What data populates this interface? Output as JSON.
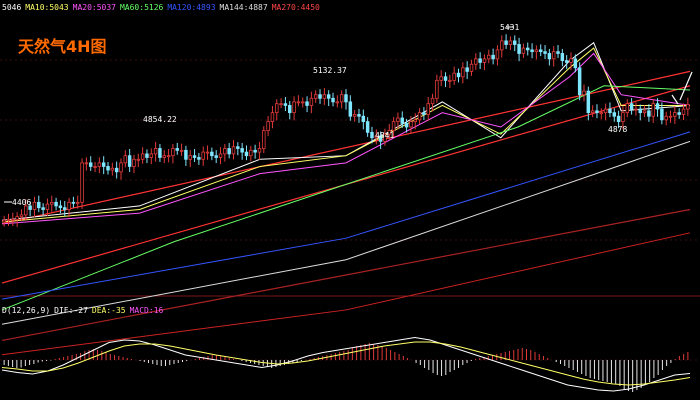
{
  "chart_data": {
    "type": "candlestick",
    "title": "天然气4H图",
    "colors": {
      "background": "#000000",
      "bull": "#e23a3a",
      "bear": "#7fe7ff",
      "title": "#ff6a00",
      "grid": "#7a1a1a"
    },
    "ma_legend": [
      {
        "label": "5046",
        "color": "#ffffff"
      },
      {
        "label": "MA10:5043",
        "color": "#ffff66"
      },
      {
        "label": "MA20:5037",
        "color": "#ff55ff"
      },
      {
        "label": "MA60:5126",
        "color": "#66ff66"
      },
      {
        "label": "MA120:4893",
        "color": "#3355ff"
      },
      {
        "label": "MA144:4887",
        "color": "#dddddd"
      },
      {
        "label": "MA270:4450",
        "color": "#ff4444"
      }
    ],
    "price_labels": [
      "4406",
      "4854.22",
      "5132.37",
      "4841",
      "5431",
      "4878"
    ],
    "ylim": [
      4000,
      5550
    ],
    "close": [
      4400,
      4405,
      4405,
      4420,
      4430,
      4480,
      4460,
      4500,
      4470,
      4460,
      4490,
      4500,
      4480,
      4470,
      4460,
      4500,
      4495,
      4500,
      4720,
      4720,
      4700,
      4700,
      4720,
      4700,
      4680,
      4690,
      4670,
      4720,
      4760,
      4700,
      4740,
      4740,
      4770,
      4750,
      4770,
      4800,
      4750,
      4760,
      4760,
      4800,
      4790,
      4790,
      4740,
      4760,
      4750,
      4740,
      4780,
      4780,
      4760,
      4750,
      4770,
      4800,
      4770,
      4810,
      4800,
      4780,
      4760,
      4790,
      4780,
      4800,
      4900,
      4950,
      5000,
      5050,
      5050,
      5040,
      5000,
      5060,
      5060,
      5060,
      5040,
      5080,
      5100,
      5080,
      5100,
      5080,
      5060,
      5060,
      5100,
      5060,
      4980,
      4990,
      4980,
      4950,
      4890,
      4860,
      4870,
      4840,
      4880,
      4900,
      4950,
      4970,
      4940,
      4920,
      4950,
      4960,
      5000,
      4990,
      5050,
      5080,
      5180,
      5200,
      5180,
      5180,
      5220,
      5200,
      5250,
      5230,
      5270,
      5300,
      5280,
      5300,
      5320,
      5300,
      5350,
      5400,
      5380,
      5400,
      5380,
      5330,
      5360,
      5350,
      5340,
      5350,
      5340,
      5330,
      5300,
      5340,
      5330,
      5290,
      5280,
      5300,
      5250,
      5100,
      5120,
      5000,
      5010,
      5000,
      5000,
      5020,
      5000,
      4980,
      4950,
      5000,
      5050,
      5020,
      5020,
      5000,
      5010,
      4980,
      5050,
      5020,
      4960,
      4980,
      4980,
      5000,
      4990,
      5020,
      5046
    ],
    "ma_series": [
      {
        "label": "MA5",
        "color": "#ffffff",
        "x": [
          0,
          40,
          75,
          100,
          128,
          145,
          165,
          172,
          180,
          200
        ],
        "y": [
          4400,
          4480,
          4740,
          4760,
          5060,
          4860,
          5290,
          5390,
          5010,
          5040
        ]
      },
      {
        "label": "MA10",
        "color": "#ffff66",
        "x": [
          0,
          40,
          75,
          100,
          128,
          145,
          165,
          172,
          180,
          200
        ],
        "y": [
          4390,
          4460,
          4700,
          4760,
          5040,
          4880,
          5250,
          5360,
          5040,
          5040
        ]
      },
      {
        "label": "MA20",
        "color": "#ff55ff",
        "x": [
          0,
          40,
          75,
          100,
          128,
          145,
          165,
          172,
          180,
          200
        ],
        "y": [
          4380,
          4440,
          4660,
          4720,
          5000,
          4920,
          5200,
          5330,
          5100,
          5040
        ]
      },
      {
        "label": "MA60",
        "color": "#66ff66",
        "x": [
          0,
          50,
          100,
          150,
          175,
          200
        ],
        "y": [
          3900,
          4280,
          4600,
          4920,
          5150,
          5126
        ]
      },
      {
        "label": "MA120",
        "color": "#3355ff",
        "x": [
          0,
          100,
          200
        ],
        "y": [
          3960,
          4300,
          4893
        ]
      },
      {
        "label": "MA144",
        "color": "#dddddd",
        "x": [
          0,
          100,
          200
        ],
        "y": [
          3820,
          4180,
          4840
        ]
      },
      {
        "label": "MA270",
        "color": "#cc2222",
        "x": [
          0,
          100,
          200
        ],
        "y": [
          3650,
          3900,
          4330
        ]
      }
    ],
    "trend_lines": [
      {
        "color": "#ff3333",
        "x": [
          0,
          200
        ],
        "y": [
          4050,
          5150
        ]
      },
      {
        "color": "#ff3333",
        "x": [
          0,
          200
        ],
        "y": [
          4380,
          5230
        ]
      },
      {
        "color": "#aa2222",
        "x": [
          0,
          200
        ],
        "y": [
          3730,
          4460
        ]
      }
    ],
    "macd": {
      "label": "D(12,26,9) DIF:-27 DEA:-35 MACD:16",
      "label_parts": [
        {
          "text": "D(12,26,9)",
          "color": "#ffffff"
        },
        {
          "text": "DIF:-27",
          "color": "#ffffff"
        },
        {
          "text": "DEA:-35",
          "color": "#ffff66"
        },
        {
          "text": "MACD:16",
          "color": "#ff55ff"
        }
      ],
      "ylim": [
        -80,
        80
      ],
      "hist": [
        -10,
        -12,
        -14,
        -16,
        -15,
        -12,
        -10,
        -8,
        -5,
        -3,
        -2,
        -1,
        2,
        4,
        6,
        8,
        10,
        12,
        14,
        18,
        20,
        22,
        20,
        18,
        15,
        12,
        10,
        8,
        6,
        4,
        2,
        0,
        -2,
        -4,
        -6,
        -8,
        -10,
        -12,
        -12,
        -10,
        -8,
        -6,
        -4,
        -2,
        0,
        2,
        4,
        6,
        8,
        10,
        10,
        8,
        6,
        4,
        2,
        0,
        -2,
        -4,
        -6,
        -8,
        -10,
        -12,
        -14,
        -16,
        -14,
        -12,
        -10,
        -8,
        -6,
        -4,
        -2,
        0,
        2,
        4,
        6,
        8,
        10,
        12,
        14,
        16,
        18,
        20,
        24,
        28,
        30,
        32,
        34,
        32,
        30,
        28,
        24,
        20,
        16,
        12,
        8,
        4,
        0,
        -6,
        -10,
        -16,
        -20,
        -26,
        -30,
        -32,
        -30,
        -24,
        -20,
        -16,
        -10,
        -6,
        -2,
        2,
        4,
        6,
        8,
        10,
        12,
        14,
        16,
        18,
        20,
        22,
        24,
        22,
        20,
        16,
        12,
        8,
        4,
        0,
        -4,
        -8,
        -12,
        -16,
        -20,
        -24,
        -28,
        -32,
        -36,
        -38,
        -40,
        -42,
        -44,
        -46,
        -48,
        -52,
        -58,
        -62,
        -64,
        -60,
        -56,
        -50,
        -44,
        -36,
        -30,
        -20,
        -12,
        -6,
        2,
        8,
        12,
        16
      ],
      "dif": [
        -20,
        -25,
        -28,
        -22,
        -10,
        5,
        20,
        35,
        40,
        38,
        30,
        20,
        10,
        5,
        0,
        -5,
        -10,
        -15,
        -10,
        -2,
        8,
        15,
        20,
        25,
        30,
        35,
        40,
        45,
        40,
        30,
        20,
        10,
        0,
        -10,
        -20,
        -30,
        -40,
        -50,
        -55,
        -60,
        -62,
        -58,
        -50,
        -40,
        -30,
        -27
      ],
      "dea": [
        -15,
        -18,
        -22,
        -22,
        -16,
        -6,
        6,
        18,
        28,
        32,
        32,
        28,
        22,
        16,
        10,
        5,
        0,
        -5,
        -8,
        -6,
        -2,
        4,
        10,
        16,
        22,
        28,
        32,
        36,
        36,
        32,
        26,
        18,
        10,
        2,
        -6,
        -14,
        -22,
        -30,
        -38,
        -44,
        -48,
        -50,
        -48,
        -44,
        -40,
        -35
      ]
    }
  }
}
